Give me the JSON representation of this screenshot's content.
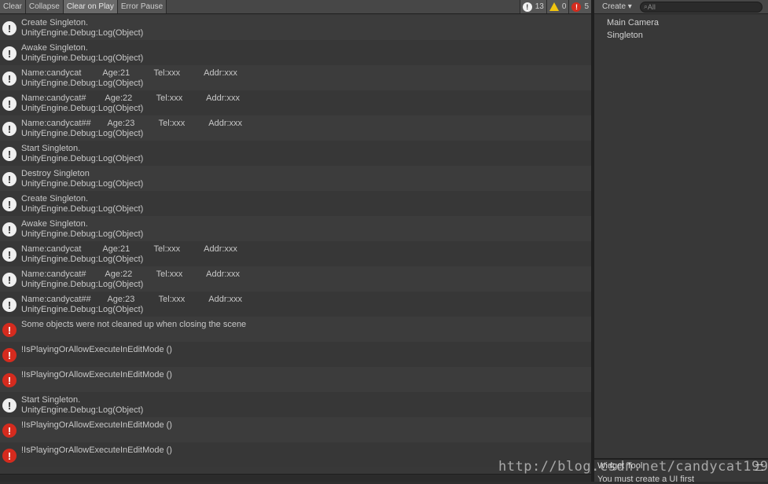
{
  "console": {
    "toolbar": {
      "buttons": [
        {
          "label": "Clear",
          "active": false
        },
        {
          "label": "Collapse",
          "active": false
        },
        {
          "label": "Clear on Play",
          "active": true
        },
        {
          "label": "Error Pause",
          "active": false
        }
      ],
      "counts": {
        "info": "13",
        "warning": "0",
        "error": "5"
      }
    },
    "logs": [
      {
        "type": "info",
        "line1": "Create Singleton.",
        "line2": "UnityEngine.Debug:Log(Object)"
      },
      {
        "type": "info",
        "line1": "Awake Singleton.",
        "line2": "UnityEngine.Debug:Log(Object)"
      },
      {
        "type": "info",
        "line1": "Name:candycat         Age:21          Tel:xxx          Addr:xxx",
        "line2": "UnityEngine.Debug:Log(Object)"
      },
      {
        "type": "info",
        "line1": "Name:candycat#        Age:22          Tel:xxx          Addr:xxx",
        "line2": "UnityEngine.Debug:Log(Object)"
      },
      {
        "type": "info",
        "line1": "Name:candycat##       Age:23          Tel:xxx          Addr:xxx",
        "line2": "UnityEngine.Debug:Log(Object)"
      },
      {
        "type": "info",
        "line1": "Start Singleton.",
        "line2": "UnityEngine.Debug:Log(Object)"
      },
      {
        "type": "info",
        "line1": "Destroy Singleton",
        "line2": "UnityEngine.Debug:Log(Object)"
      },
      {
        "type": "info",
        "line1": "Create Singleton.",
        "line2": "UnityEngine.Debug:Log(Object)"
      },
      {
        "type": "info",
        "line1": "Awake Singleton.",
        "line2": "UnityEngine.Debug:Log(Object)"
      },
      {
        "type": "info",
        "line1": "Name:candycat         Age:21          Tel:xxx          Addr:xxx",
        "line2": "UnityEngine.Debug:Log(Object)"
      },
      {
        "type": "info",
        "line1": "Name:candycat#        Age:22          Tel:xxx          Addr:xxx",
        "line2": "UnityEngine.Debug:Log(Object)"
      },
      {
        "type": "info",
        "line1": "Name:candycat##       Age:23          Tel:xxx          Addr:xxx",
        "line2": "UnityEngine.Debug:Log(Object)"
      },
      {
        "type": "error",
        "line1": "Some objects were not cleaned up when closing the scene",
        "line2": ""
      },
      {
        "type": "error",
        "line1": "!IsPlayingOrAllowExecuteInEditMode ()",
        "line2": ""
      },
      {
        "type": "error",
        "line1": "!IsPlayingOrAllowExecuteInEditMode ()",
        "line2": ""
      },
      {
        "type": "info",
        "line1": "Start Singleton.",
        "line2": "UnityEngine.Debug:Log(Object)"
      },
      {
        "type": "error",
        "line1": "!IsPlayingOrAllowExecuteInEditMode ()",
        "line2": ""
      },
      {
        "type": "error",
        "line1": "!IsPlayingOrAllowExecuteInEditMode ()",
        "line2": ""
      }
    ]
  },
  "hierarchy": {
    "create_label": "Create",
    "search_placeholder": "All",
    "items": [
      "Main Camera",
      "Singleton"
    ]
  },
  "widget_tool": {
    "tab_label": "Widget Tool",
    "message": "You must create a UI first"
  },
  "watermark": "http://blog.csdn.net/candycat1992",
  "colors": {
    "error": "#d52b1e",
    "warning": "#f1c40f",
    "info": "#efefef"
  }
}
